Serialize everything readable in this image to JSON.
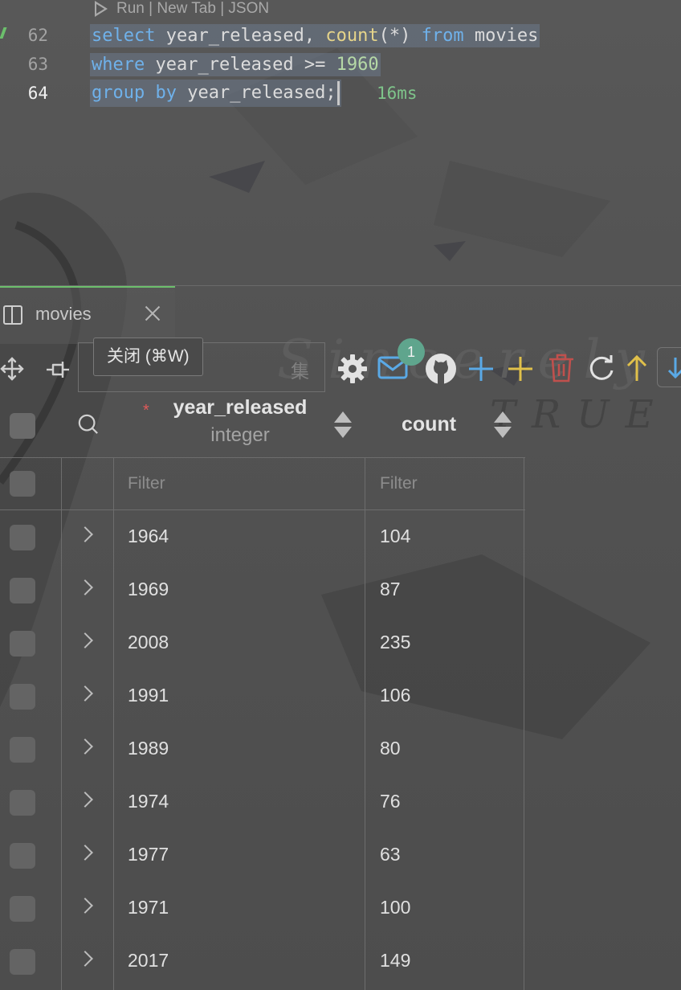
{
  "editor": {
    "codelens": "Run | New Tab | JSON",
    "lines": [
      {
        "number": "62"
      },
      {
        "number": "63"
      },
      {
        "number": "64"
      }
    ],
    "sql": {
      "l62": {
        "kw1": "select",
        "id1": " year_released, ",
        "fn": "count",
        "id2": "(*) ",
        "kw2": "from",
        "id3": " movies"
      },
      "l63": {
        "kw1": "where",
        "id1": " year_released >= ",
        "num": "1960"
      },
      "l64": {
        "kw1": "group",
        "sp": " ",
        "kw2": "by",
        "id1": " year_released;"
      }
    },
    "timing": "16ms"
  },
  "panel": {
    "tab_label": "movies",
    "tooltip": "关闭 (⌘W)",
    "search_placeholder_visible": "集",
    "notification_count": "1"
  },
  "grid": {
    "columns": [
      {
        "name": "year_released",
        "type": "integer",
        "required": "*"
      },
      {
        "name": "count"
      }
    ],
    "filter_placeholder": "Filter",
    "rows": [
      [
        "1964",
        "104"
      ],
      [
        "1969",
        "87"
      ],
      [
        "2008",
        "235"
      ],
      [
        "1991",
        "106"
      ],
      [
        "1989",
        "80"
      ],
      [
        "1974",
        "76"
      ],
      [
        "1977",
        "63"
      ],
      [
        "1971",
        "100"
      ],
      [
        "2017",
        "149"
      ]
    ]
  },
  "background_watermark": {
    "line1": "Sincerely",
    "line2": "TRUE"
  },
  "colors": {
    "accent_green": "#6cbf6c",
    "keyword_blue": "#6fb1ea",
    "function_yellow": "#e5d48a",
    "number_green": "#b5d8a6",
    "badge_teal": "#5fa58d",
    "toolbar_blue": "#5aa9e6",
    "toolbar_yellow": "#e0c04a",
    "toolbar_red": "#c0504d"
  }
}
